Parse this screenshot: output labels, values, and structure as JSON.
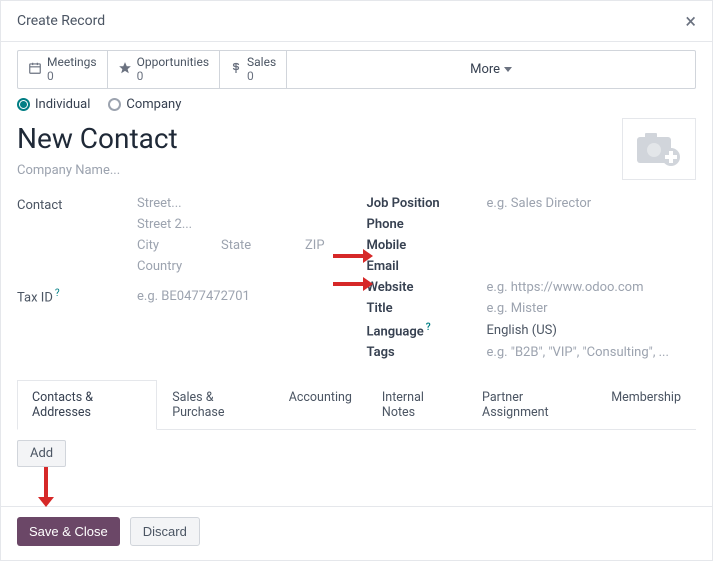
{
  "modal_title": "Create Record",
  "stats": {
    "meetings_label": "Meetings",
    "meetings_count": "0",
    "opportunities_label": "Opportunities",
    "opportunities_count": "0",
    "sales_label": "Sales",
    "sales_count": "0",
    "more_label": "More"
  },
  "radio": {
    "individual": "Individual",
    "company": "Company"
  },
  "heading": "New Contact",
  "company_placeholder": "Company Name...",
  "left": {
    "contact_label": "Contact",
    "street_ph": "Street...",
    "street2_ph": "Street 2...",
    "city_ph": "City",
    "state_ph": "State",
    "zip_ph": "ZIP",
    "country_ph": "Country",
    "taxid_label": "Tax ID",
    "taxid_ph": "e.g. BE0477472701"
  },
  "right": {
    "job_label": "Job Position",
    "job_ph": "e.g. Sales Director",
    "phone_label": "Phone",
    "mobile_label": "Mobile",
    "email_label": "Email",
    "website_label": "Website",
    "website_ph": "e.g. https://www.odoo.com",
    "title_label": "Title",
    "title_ph": "e.g. Mister",
    "language_label": "Language",
    "language_val": "English (US)",
    "tags_label": "Tags",
    "tags_ph": "e.g. \"B2B\", \"VIP\", \"Consulting\", ..."
  },
  "tabs": {
    "t0": "Contacts & Addresses",
    "t1": "Sales & Purchase",
    "t2": "Accounting",
    "t3": "Internal Notes",
    "t4": "Partner Assignment",
    "t5": "Membership"
  },
  "add_label": "Add",
  "footer": {
    "save": "Save & Close",
    "discard": "Discard"
  },
  "colors": {
    "accent": "#017e84",
    "primary_btn": "#6b4767",
    "arrow": "#d62828"
  }
}
